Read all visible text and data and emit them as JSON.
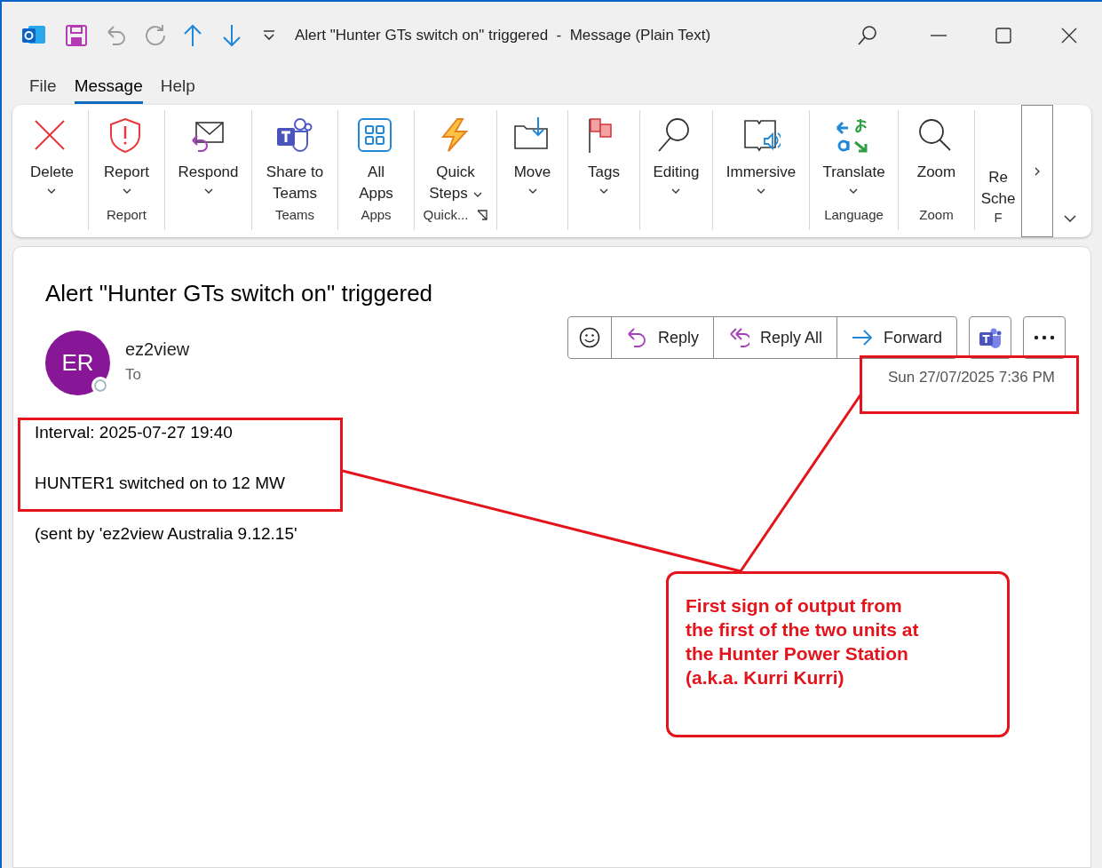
{
  "window": {
    "title": "Alert \"Hunter GTs switch on\" triggered  -  Message (Plain Text)"
  },
  "menu_tabs": [
    {
      "label": "File",
      "selected": false
    },
    {
      "label": "Message",
      "selected": true
    },
    {
      "label": "Help",
      "selected": false
    }
  ],
  "ribbon": {
    "groups": [
      {
        "buttons": [
          {
            "kind": "delete",
            "lines": [
              "Delete"
            ],
            "has_dropdown": true
          }
        ]
      },
      {
        "label": "Report",
        "buttons": [
          {
            "kind": "report",
            "lines": [
              "Report"
            ],
            "has_dropdown": true
          }
        ]
      },
      {
        "buttons": [
          {
            "kind": "respond",
            "lines": [
              "Respond"
            ],
            "has_dropdown": true
          }
        ]
      },
      {
        "label": "Teams",
        "buttons": [
          {
            "kind": "teams",
            "lines": [
              "Share to",
              "Teams"
            ],
            "has_dropdown": false
          }
        ]
      },
      {
        "label": "Apps",
        "buttons": [
          {
            "kind": "apps",
            "lines": [
              "All",
              "Apps"
            ],
            "has_dropdown": false
          }
        ]
      },
      {
        "label": "Quick...",
        "launcher": true,
        "buttons": [
          {
            "kind": "quick_steps",
            "lines": [
              "Quick",
              "Steps"
            ],
            "has_dropdown": true
          }
        ]
      },
      {
        "buttons": [
          {
            "kind": "move",
            "lines": [
              "Move"
            ],
            "has_dropdown": true
          }
        ]
      },
      {
        "buttons": [
          {
            "kind": "tags",
            "lines": [
              "Tags"
            ],
            "has_dropdown": true
          }
        ]
      },
      {
        "buttons": [
          {
            "kind": "editing",
            "lines": [
              "Editing"
            ],
            "has_dropdown": true
          }
        ]
      },
      {
        "buttons": [
          {
            "kind": "immersive",
            "lines": [
              "Immersive"
            ],
            "has_dropdown": true
          }
        ]
      },
      {
        "label": "Language",
        "buttons": [
          {
            "kind": "translate",
            "lines": [
              "Translate"
            ],
            "has_dropdown": true
          }
        ]
      },
      {
        "label": "Zoom",
        "buttons": [
          {
            "kind": "zoom",
            "lines": [
              "Zoom"
            ],
            "has_dropdown": false
          }
        ]
      },
      {
        "label": "F",
        "buttons": [
          {
            "kind": "clipped",
            "lines": [
              "Re",
              "Sche"
            ],
            "has_dropdown": false
          }
        ]
      }
    ]
  },
  "message": {
    "subject": "Alert \"Hunter GTs switch on\" triggered",
    "sender": {
      "initials": "ER",
      "name": "ez2view",
      "to_label": "To"
    },
    "actions": [
      {
        "kind": "emoji"
      },
      {
        "kind": "reply",
        "label": "Reply"
      },
      {
        "kind": "reply_all",
        "label": "Reply All"
      },
      {
        "kind": "forward",
        "label": "Forward"
      }
    ],
    "date": "Sun 27/07/2025 7:36 PM",
    "body": [
      "Interval: 2025-07-27 19:40",
      "HUNTER1 switched on to 12 MW",
      "(sent by 'ez2view Australia 9.12.15'"
    ]
  },
  "annotation": {
    "text": "First sign of output from\nthe first of the two units at\nthe Hunter Power Station\n(a.k.a. Kurri Kurri)"
  }
}
